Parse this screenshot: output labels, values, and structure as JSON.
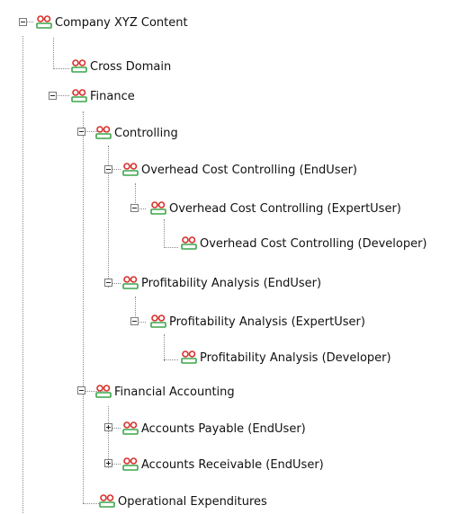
{
  "tree": {
    "nodes": [
      {
        "label": "Company XYZ Content",
        "state": "expanded",
        "icon": "user-group-icon"
      },
      {
        "label": "Cross Domain",
        "state": "leaf",
        "icon": "user-group-icon"
      },
      {
        "label": "Finance",
        "state": "expanded",
        "icon": "user-group-icon"
      },
      {
        "label": "Controlling",
        "state": "expanded",
        "icon": "user-group-icon"
      },
      {
        "label": "Overhead Cost Controlling (EndUser)",
        "state": "expanded",
        "icon": "user-group-icon"
      },
      {
        "label": "Overhead Cost Controlling (ExpertUser)",
        "state": "expanded",
        "icon": "user-group-icon"
      },
      {
        "label": "Overhead Cost Controlling (Developer)",
        "state": "leaf",
        "icon": "user-group-icon"
      },
      {
        "label": "Profitability Analysis (EndUser)",
        "state": "expanded",
        "icon": "user-group-icon"
      },
      {
        "label": "Profitability Analysis (ExpertUser)",
        "state": "expanded",
        "icon": "user-group-icon"
      },
      {
        "label": "Profitability Analysis (Developer)",
        "state": "leaf",
        "icon": "user-group-icon"
      },
      {
        "label": "Financial Accounting",
        "state": "expanded",
        "icon": "user-group-icon"
      },
      {
        "label": "Accounts Payable (EndUser)",
        "state": "collapsed",
        "icon": "user-group-icon"
      },
      {
        "label": "Accounts Receivable (EndUser)",
        "state": "collapsed",
        "icon": "user-group-icon"
      },
      {
        "label": "Operational Expenditures",
        "state": "leaf",
        "icon": "user-group-icon"
      }
    ]
  },
  "colors": {
    "person_red": "#d9302b",
    "person_green": "#3aa64a",
    "connector": "#8a8a8a"
  }
}
